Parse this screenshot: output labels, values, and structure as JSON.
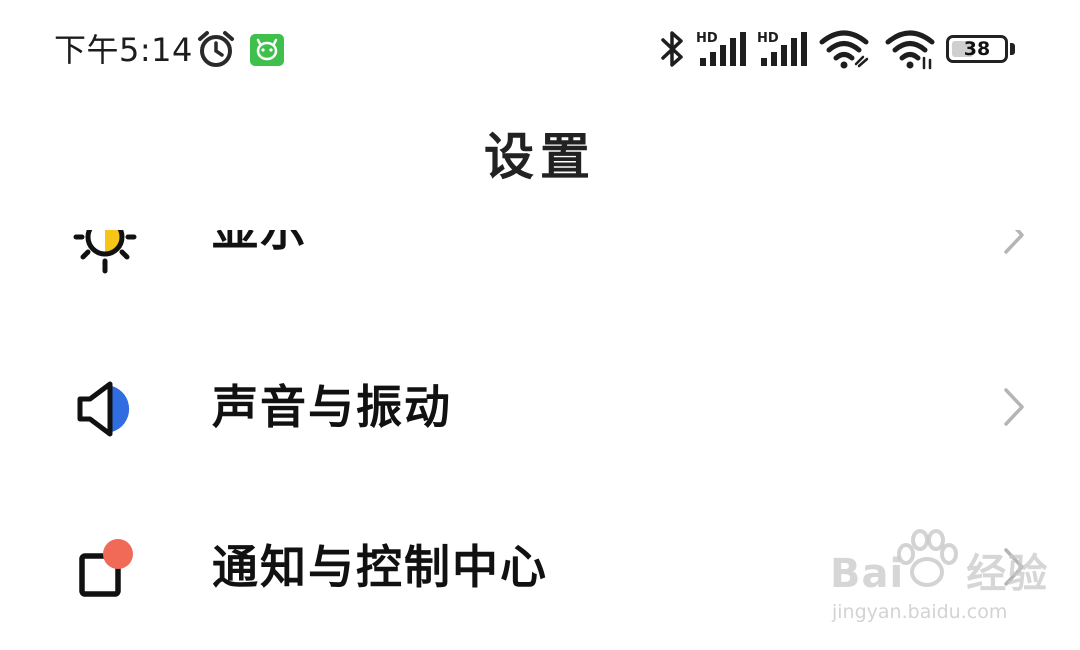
{
  "status_bar": {
    "time": "下午5:14",
    "battery_percent": "38",
    "signal_1_label": "HD",
    "signal_2_label": "HD",
    "icons": [
      "alarm-clock-icon",
      "app-notification-icon",
      "bluetooth-icon",
      "signal-hd-icon",
      "signal-hd-icon",
      "wifi-link-icon",
      "wifi-icon",
      "battery-icon"
    ]
  },
  "header": {
    "title": "设置"
  },
  "settings_list": {
    "items": [
      {
        "label": "显示",
        "icon": "brightness-icon"
      },
      {
        "label": "声音与振动",
        "icon": "speaker-icon"
      },
      {
        "label": "通知与控制中心",
        "icon": "notification-icon"
      }
    ]
  },
  "watermark": {
    "brand_prefix": "Bai",
    "brand_suffix": "经验",
    "url": "jingyan.baidu.com"
  },
  "colors": {
    "accent_blue": "#2f6de1",
    "accent_yellow": "#f5c518",
    "accent_red": "#f06a57",
    "app_green": "#3fbf4c"
  }
}
